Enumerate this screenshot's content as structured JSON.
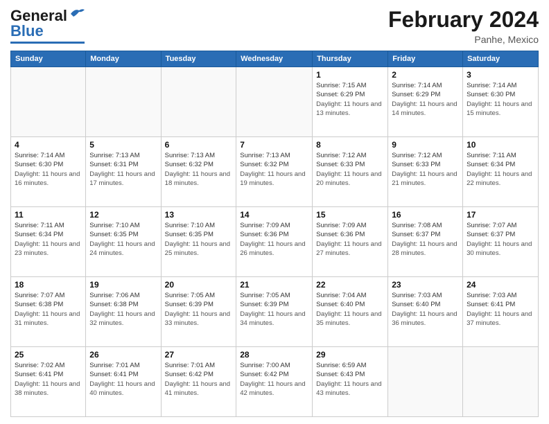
{
  "logo": {
    "text_general": "General",
    "text_blue": "Blue"
  },
  "title": "February 2024",
  "subtitle": "Panhe, Mexico",
  "days_of_week": [
    "Sunday",
    "Monday",
    "Tuesday",
    "Wednesday",
    "Thursday",
    "Friday",
    "Saturday"
  ],
  "weeks": [
    [
      {
        "num": "",
        "info": ""
      },
      {
        "num": "",
        "info": ""
      },
      {
        "num": "",
        "info": ""
      },
      {
        "num": "",
        "info": ""
      },
      {
        "num": "1",
        "sunrise": "7:15 AM",
        "sunset": "6:29 PM",
        "daylight": "11 hours and 13 minutes."
      },
      {
        "num": "2",
        "sunrise": "7:14 AM",
        "sunset": "6:29 PM",
        "daylight": "11 hours and 14 minutes."
      },
      {
        "num": "3",
        "sunrise": "7:14 AM",
        "sunset": "6:30 PM",
        "daylight": "11 hours and 15 minutes."
      }
    ],
    [
      {
        "num": "4",
        "sunrise": "7:14 AM",
        "sunset": "6:30 PM",
        "daylight": "11 hours and 16 minutes."
      },
      {
        "num": "5",
        "sunrise": "7:13 AM",
        "sunset": "6:31 PM",
        "daylight": "11 hours and 17 minutes."
      },
      {
        "num": "6",
        "sunrise": "7:13 AM",
        "sunset": "6:32 PM",
        "daylight": "11 hours and 18 minutes."
      },
      {
        "num": "7",
        "sunrise": "7:13 AM",
        "sunset": "6:32 PM",
        "daylight": "11 hours and 19 minutes."
      },
      {
        "num": "8",
        "sunrise": "7:12 AM",
        "sunset": "6:33 PM",
        "daylight": "11 hours and 20 minutes."
      },
      {
        "num": "9",
        "sunrise": "7:12 AM",
        "sunset": "6:33 PM",
        "daylight": "11 hours and 21 minutes."
      },
      {
        "num": "10",
        "sunrise": "7:11 AM",
        "sunset": "6:34 PM",
        "daylight": "11 hours and 22 minutes."
      }
    ],
    [
      {
        "num": "11",
        "sunrise": "7:11 AM",
        "sunset": "6:34 PM",
        "daylight": "11 hours and 23 minutes."
      },
      {
        "num": "12",
        "sunrise": "7:10 AM",
        "sunset": "6:35 PM",
        "daylight": "11 hours and 24 minutes."
      },
      {
        "num": "13",
        "sunrise": "7:10 AM",
        "sunset": "6:35 PM",
        "daylight": "11 hours and 25 minutes."
      },
      {
        "num": "14",
        "sunrise": "7:09 AM",
        "sunset": "6:36 PM",
        "daylight": "11 hours and 26 minutes."
      },
      {
        "num": "15",
        "sunrise": "7:09 AM",
        "sunset": "6:36 PM",
        "daylight": "11 hours and 27 minutes."
      },
      {
        "num": "16",
        "sunrise": "7:08 AM",
        "sunset": "6:37 PM",
        "daylight": "11 hours and 28 minutes."
      },
      {
        "num": "17",
        "sunrise": "7:07 AM",
        "sunset": "6:37 PM",
        "daylight": "11 hours and 30 minutes."
      }
    ],
    [
      {
        "num": "18",
        "sunrise": "7:07 AM",
        "sunset": "6:38 PM",
        "daylight": "11 hours and 31 minutes."
      },
      {
        "num": "19",
        "sunrise": "7:06 AM",
        "sunset": "6:38 PM",
        "daylight": "11 hours and 32 minutes."
      },
      {
        "num": "20",
        "sunrise": "7:05 AM",
        "sunset": "6:39 PM",
        "daylight": "11 hours and 33 minutes."
      },
      {
        "num": "21",
        "sunrise": "7:05 AM",
        "sunset": "6:39 PM",
        "daylight": "11 hours and 34 minutes."
      },
      {
        "num": "22",
        "sunrise": "7:04 AM",
        "sunset": "6:40 PM",
        "daylight": "11 hours and 35 minutes."
      },
      {
        "num": "23",
        "sunrise": "7:03 AM",
        "sunset": "6:40 PM",
        "daylight": "11 hours and 36 minutes."
      },
      {
        "num": "24",
        "sunrise": "7:03 AM",
        "sunset": "6:41 PM",
        "daylight": "11 hours and 37 minutes."
      }
    ],
    [
      {
        "num": "25",
        "sunrise": "7:02 AM",
        "sunset": "6:41 PM",
        "daylight": "11 hours and 38 minutes."
      },
      {
        "num": "26",
        "sunrise": "7:01 AM",
        "sunset": "6:41 PM",
        "daylight": "11 hours and 40 minutes."
      },
      {
        "num": "27",
        "sunrise": "7:01 AM",
        "sunset": "6:42 PM",
        "daylight": "11 hours and 41 minutes."
      },
      {
        "num": "28",
        "sunrise": "7:00 AM",
        "sunset": "6:42 PM",
        "daylight": "11 hours and 42 minutes."
      },
      {
        "num": "29",
        "sunrise": "6:59 AM",
        "sunset": "6:43 PM",
        "daylight": "11 hours and 43 minutes."
      },
      {
        "num": "",
        "info": ""
      },
      {
        "num": "",
        "info": ""
      }
    ]
  ],
  "label_sunrise": "Sunrise:",
  "label_sunset": "Sunset:",
  "label_daylight": "Daylight:"
}
